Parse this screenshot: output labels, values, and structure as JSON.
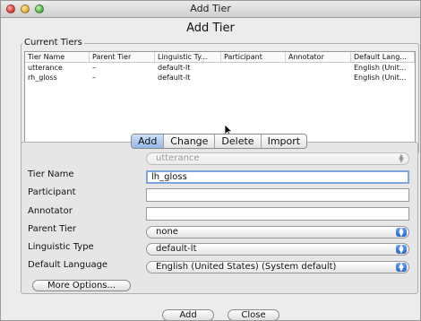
{
  "window": {
    "title": "Add Tier",
    "heading": "Add Tier"
  },
  "current_tiers": {
    "group_label": "Current Tiers",
    "columns": [
      "Tier Name",
      "Parent Tier",
      "Linguistic Ty...",
      "Participant",
      "Annotator",
      "Default Lang..."
    ],
    "rows": [
      [
        "utterance",
        "–",
        "default-lt",
        "",
        "",
        "English (Unit..."
      ],
      [
        "rh_gloss",
        "–",
        "default-lt",
        "",
        "",
        "English (Unit..."
      ]
    ]
  },
  "mode_tabs": [
    "Add",
    "Change",
    "Delete",
    "Import"
  ],
  "form": {
    "tier_select_value": "utterance",
    "tier_name_label": "Tier Name",
    "tier_name_value": "lh_gloss",
    "participant_label": "Participant",
    "participant_value": "",
    "annotator_label": "Annotator",
    "annotator_value": "",
    "parent_tier_label": "Parent Tier",
    "parent_tier_value": "none",
    "linguistic_type_label": "Linguistic Type",
    "linguistic_type_value": "default-lt",
    "default_language_label": "Default Language",
    "default_language_value": "English (United States) (System default)",
    "more_options_label": "More Options..."
  },
  "buttons": {
    "add": "Add",
    "close": "Close"
  },
  "colors": {
    "active_tab": "#94b7e8",
    "select_arrow": "#2a66cc",
    "focus_ring": "#7fa6d9"
  }
}
